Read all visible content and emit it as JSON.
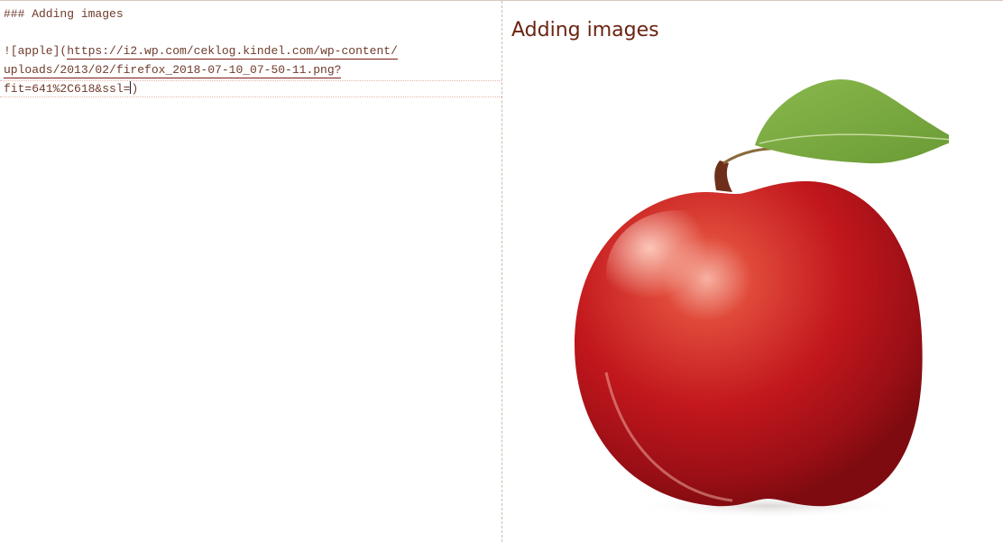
{
  "editor": {
    "line1": "### Adding images",
    "line2_prefix": "![apple](",
    "line2_url": "https://i2.wp.com/ceklog.kindel.com/wp-content/",
    "line3_url": "uploads/2013/02/firefox_2018-07-10_07-50-11.png?",
    "line4_text": "fit=641%2C618&ssl=",
    "line4_suffix": ")"
  },
  "preview": {
    "heading": "Adding images",
    "image_alt": "apple"
  },
  "colors": {
    "apple_red": "#b8161c",
    "leaf_green": "#7aa642",
    "text_brown": "#6b2411"
  }
}
